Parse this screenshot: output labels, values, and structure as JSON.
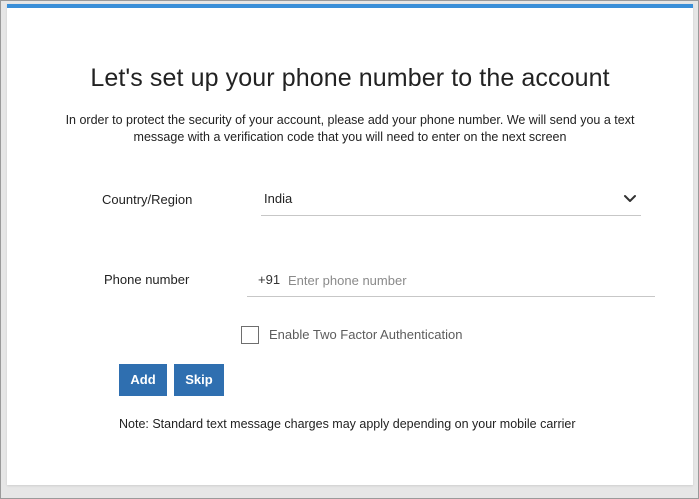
{
  "header": {
    "title": "Let's set up your phone number to the account",
    "description": "In order to protect the security of your account, please add your phone number. We will send you a text message with a verification code that you will need to enter on the next screen"
  },
  "form": {
    "country": {
      "label": "Country/Region",
      "selected": "India",
      "icon": "chevron-down-icon"
    },
    "phone": {
      "label": "Phone number",
      "prefix": "+91",
      "value": "",
      "placeholder": "Enter phone number"
    },
    "two_factor": {
      "label": "Enable Two Factor Authentication",
      "checked": false
    }
  },
  "actions": {
    "add_label": "Add",
    "skip_label": "Skip"
  },
  "footer": {
    "note": "Note: Standard text message charges may apply depending on your mobile carrier"
  },
  "colors": {
    "accent_bar": "#3a8fd8",
    "button": "#2f6fb0"
  }
}
